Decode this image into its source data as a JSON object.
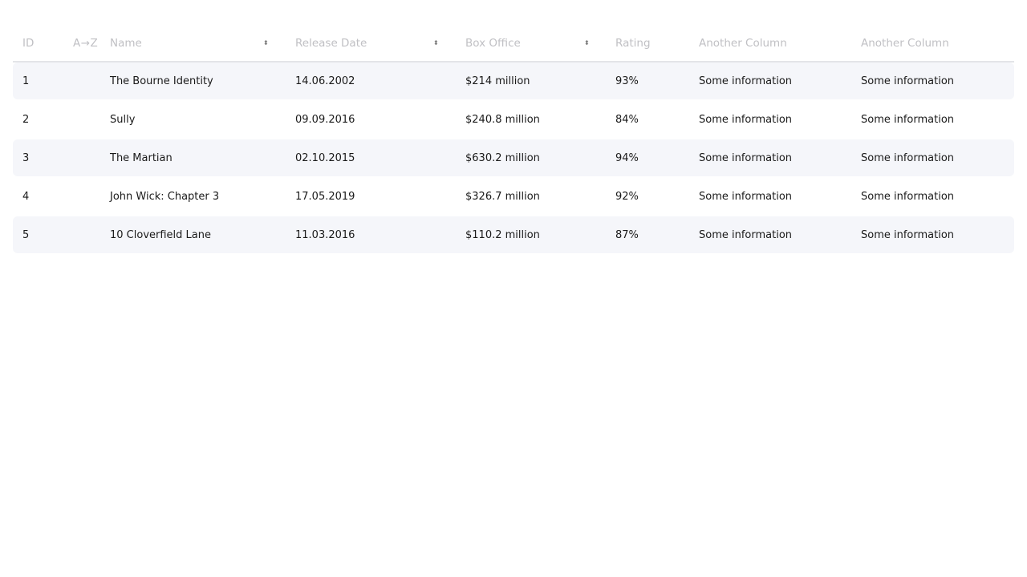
{
  "headers": {
    "id": "ID",
    "az": "A→Z",
    "name": "Name",
    "release": "Release Date",
    "box": "Box Office",
    "rating": "Rating",
    "another1": "Another Column",
    "another2": "Another Column"
  },
  "sort_icon": "⬍",
  "rows": [
    {
      "id": "1",
      "name": "The Bourne Identity",
      "release": "14.06.2002",
      "box": "$214 million",
      "rating": "93%",
      "a1": "Some information",
      "a2": "Some information"
    },
    {
      "id": "2",
      "name": "Sully",
      "release": "09.09.2016",
      "box": "$240.8 million",
      "rating": "84%",
      "a1": "Some information",
      "a2": "Some information"
    },
    {
      "id": "3",
      "name": "The Martian",
      "release": "02.10.2015",
      "box": "$630.2 million",
      "rating": "94%",
      "a1": "Some information",
      "a2": "Some information"
    },
    {
      "id": "4",
      "name": "John Wick: Chapter 3",
      "release": "17.05.2019",
      "box": "$326.7 million",
      "rating": "92%",
      "a1": "Some information",
      "a2": "Some information"
    },
    {
      "id": "5",
      "name": "10 Cloverfield Lane",
      "release": "11.03.2016",
      "box": "$110.2 million",
      "rating": "87%",
      "a1": "Some information",
      "a2": "Some information"
    }
  ]
}
